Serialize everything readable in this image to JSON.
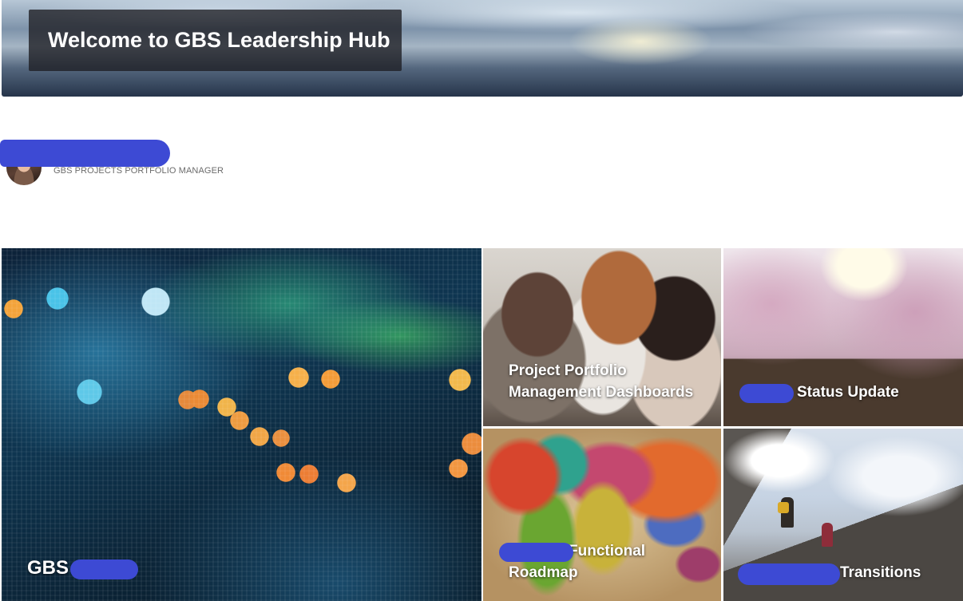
{
  "banner": {
    "title": "Welcome to GBS Leadership Hub"
  },
  "person": {
    "role": "GBS PROJECTS PORTFOLIO MANAGER"
  },
  "tiles": [
    {
      "title": "GBS"
    },
    {
      "title": "Project Portfolio Management Dashboards"
    },
    {
      "title": "Status Update"
    },
    {
      "title": "Functional Roadmap"
    },
    {
      "title": "Transitions"
    }
  ],
  "colors": {
    "redaction": "#3d4ad4",
    "title_box": "#1e1e22",
    "tile_text": "#ffffff",
    "role_text": "#6b6b6b"
  }
}
